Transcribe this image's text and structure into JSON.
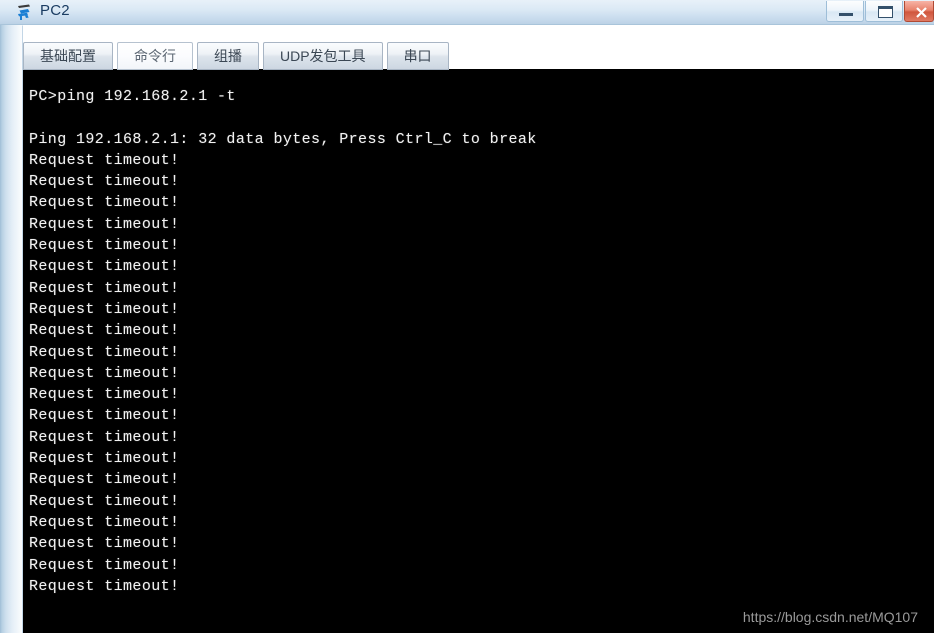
{
  "window": {
    "title": "PC2",
    "icon": "pc-device-icon",
    "controls": [
      {
        "name": "minimize-button",
        "label": "—",
        "icon": "minimize-icon"
      },
      {
        "name": "maximize-button",
        "label": "❐",
        "icon": "maximize-icon"
      },
      {
        "name": "close-button",
        "label": "✕",
        "icon": "close-icon"
      }
    ]
  },
  "tabs": [
    {
      "label": "基础配置",
      "name": "tab-basic-config",
      "active": false
    },
    {
      "label": "命令行",
      "name": "tab-command-line",
      "active": true
    },
    {
      "label": "组播",
      "name": "tab-multicast",
      "active": false
    },
    {
      "label": "UDP发包工具",
      "name": "tab-udp-tool",
      "active": false
    },
    {
      "label": "串口",
      "name": "tab-serial-port",
      "active": false
    }
  ],
  "terminal": {
    "background_color": "#000000",
    "text_color": "#f2f2f2",
    "lines": [
      "PC>ping 192.168.2.1 -t",
      "",
      "Ping 192.168.2.1: 32 data bytes, Press Ctrl_C to break",
      "Request timeout!",
      "Request timeout!",
      "Request timeout!",
      "Request timeout!",
      "Request timeout!",
      "Request timeout!",
      "Request timeout!",
      "Request timeout!",
      "Request timeout!",
      "Request timeout!",
      "Request timeout!",
      "Request timeout!",
      "Request timeout!",
      "Request timeout!",
      "Request timeout!",
      "Request timeout!",
      "Request timeout!",
      "Request timeout!",
      "Request timeout!",
      "Request timeout!",
      "Request timeout!"
    ]
  },
  "watermark": {
    "text": "https://blog.csdn.net/MQ107"
  }
}
